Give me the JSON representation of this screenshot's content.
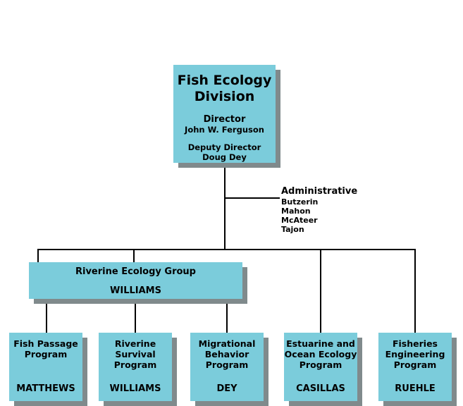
{
  "root": {
    "title": "Fish Ecology\nDivision",
    "director_label": "Director",
    "director_name": "John W. Ferguson",
    "deputy_label": "Deputy Director",
    "deputy_name": "Doug Dey"
  },
  "administrative": {
    "title": "Administrative",
    "names": [
      "Butzerin",
      "Mahon",
      "McAteer",
      "Tajon"
    ]
  },
  "group": {
    "title": "Riverine Ecology Group",
    "lead": "WILLIAMS"
  },
  "programs": [
    {
      "title": "Fish Passage\nProgram",
      "lead": "MATTHEWS"
    },
    {
      "title": "Riverine\nSurvival\nProgram",
      "lead": "WILLIAMS"
    },
    {
      "title": "Migrational\nBehavior\nProgram",
      "lead": "DEY"
    },
    {
      "title": "Estuarine and\nOcean Ecology\nProgram",
      "lead": "CASILLAS"
    },
    {
      "title": "Fisheries\nEngineering\nProgram",
      "lead": "RUEHLE"
    }
  ],
  "colors": {
    "box_fill": "#7bccdb",
    "box_shadow": "#808a8c",
    "line": "#000000",
    "text": "#000000",
    "background": "#ffffff"
  }
}
